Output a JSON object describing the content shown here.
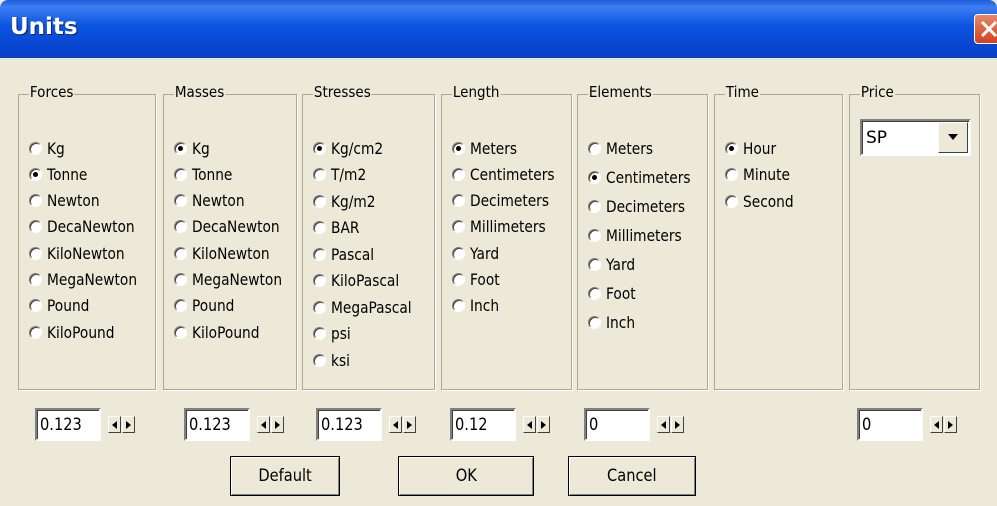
{
  "window": {
    "title": "Units"
  },
  "groups": {
    "forces": {
      "legend": "Forces",
      "options": [
        "Kg",
        "Tonne",
        "Newton",
        "DecaNewton",
        "KiloNewton",
        "MegaNewton",
        "Pound",
        "KiloPound"
      ],
      "selected": "Tonne"
    },
    "masses": {
      "legend": "Masses",
      "options": [
        "Kg",
        "Tonne",
        "Newton",
        "DecaNewton",
        "KiloNewton",
        "MegaNewton",
        "Pound",
        "KiloPound"
      ],
      "selected": "Kg"
    },
    "stresses": {
      "legend": "Stresses",
      "options": [
        "Kg/cm2",
        "T/m2",
        "Kg/m2",
        "BAR",
        "Pascal",
        "KiloPascal",
        "MegaPascal",
        "psi",
        "ksi"
      ],
      "selected": "Kg/cm2"
    },
    "length": {
      "legend": "Length",
      "options": [
        "Meters",
        "Centimeters",
        "Decimeters",
        "Millimeters",
        "Yard",
        "Foot",
        "Inch"
      ],
      "selected": "Meters"
    },
    "elements": {
      "legend": "Elements",
      "options": [
        "Meters",
        "Centimeters",
        "Decimeters",
        "Millimeters",
        "Yard",
        "Foot",
        "Inch"
      ],
      "selected": "Centimeters"
    },
    "time": {
      "legend": "Time",
      "options": [
        "Hour",
        "Minute",
        "Second"
      ],
      "selected": "Hour"
    },
    "price": {
      "legend": "Price",
      "selected_value": "SP"
    }
  },
  "precision": {
    "forces": "0.123",
    "masses": "0.123",
    "stresses": "0.123",
    "length": "0.12",
    "elements": "0",
    "price": "0"
  },
  "buttons": {
    "default": "Default",
    "ok": "OK",
    "cancel": "Cancel"
  },
  "icons": {
    "close": "close-x-icon",
    "dropdown": "chevron-down-icon",
    "spin_left": "arrow-left-icon",
    "spin_right": "arrow-right-icon"
  },
  "colors": {
    "titlebar": "#0a53e0",
    "dialog": "#ece9d8",
    "close": "#d2411f"
  }
}
